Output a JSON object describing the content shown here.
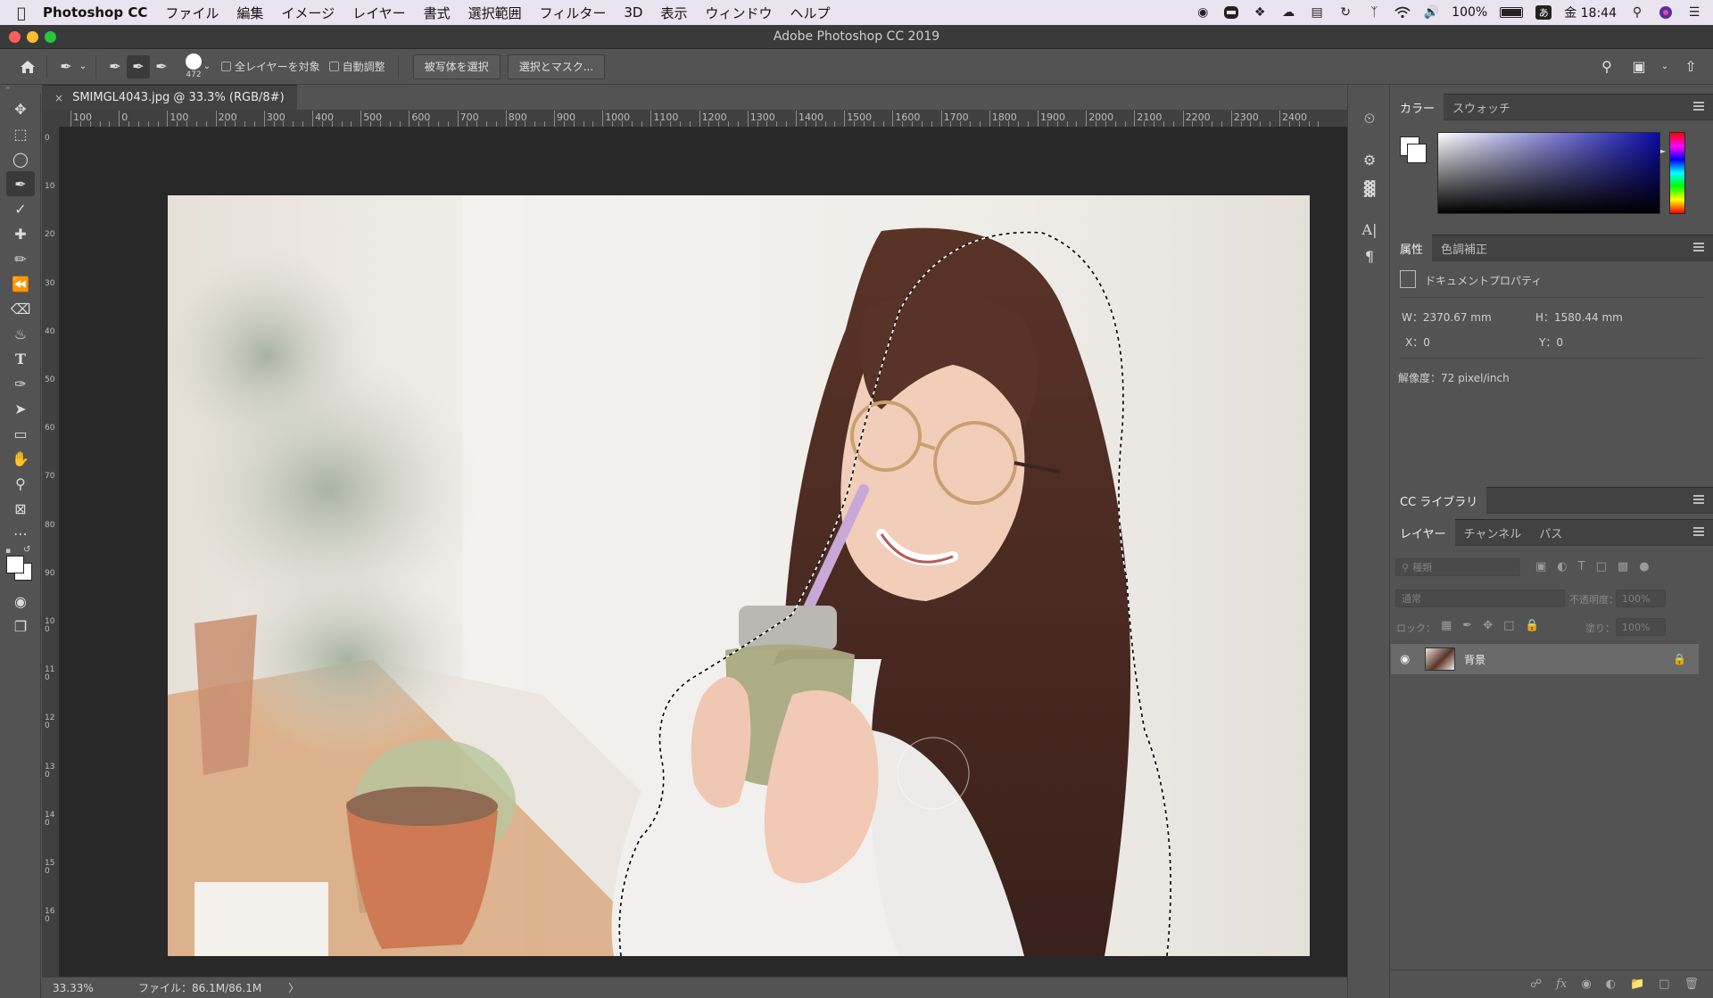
{
  "menubar": {
    "app_name": "Photoshop CC",
    "items": [
      "ファイル",
      "編集",
      "イメージ",
      "レイヤー",
      "書式",
      "選択範囲",
      "フィルター",
      "3D",
      "表示",
      "ウィンドウ",
      "ヘルプ"
    ],
    "battery": "100%",
    "ime": "あ",
    "clock": "金 18:44"
  },
  "window": {
    "title": "Adobe Photoshop CC 2019"
  },
  "options": {
    "brush_size": "472",
    "sample_all_layers": "全レイヤーを対象",
    "auto_enhance": "自動調整",
    "select_subject": "被写体を選択",
    "select_and_mask": "選択とマスク..."
  },
  "document": {
    "tab_title": "SMIMGL4043.jpg @ 33.3% (RGB/8#)",
    "close_glyph": "×",
    "ruler_top": [
      "100",
      "0",
      "100",
      "200",
      "300",
      "400",
      "500",
      "600",
      "700",
      "800",
      "900",
      "1000",
      "1100",
      "1200",
      "1300",
      "1400",
      "1500",
      "1600",
      "1700",
      "1800",
      "1900",
      "2000",
      "2100",
      "2200",
      "2300",
      "2400"
    ],
    "ruler_left": [
      "0",
      "1 0",
      "2 0",
      "3 0",
      "4 0",
      "5 0",
      "6 0",
      "7 0",
      "8 0",
      "9 0",
      "1 0 0",
      "1 1 0",
      "1 2 0",
      "1 3 0",
      "1 4 0",
      "1 5 0",
      "1 6 0"
    ]
  },
  "status": {
    "zoom": "33.33%",
    "file_info": "ファイル：86.1M/86.1M",
    "arrow": "〉"
  },
  "color_panel": {
    "tabs": [
      "カラー",
      "スウォッチ"
    ],
    "active_tab": "カラー",
    "hue_color": "#0a0aa8"
  },
  "properties_panel": {
    "tabs": [
      "属性",
      "色調補正"
    ],
    "header": "ドキュメントプロパティ",
    "width": "W：2370.67 mm",
    "height": "H：1580.44 mm",
    "x": "X：0",
    "y": "Y：0",
    "resolution": "解像度：72 pixel/inch"
  },
  "libraries_panel": {
    "title": "CC ライブラリ"
  },
  "layers_panel": {
    "tabs": [
      "レイヤー",
      "チャンネル",
      "パス"
    ],
    "search_placeholder": "種類",
    "blend_mode": "通常",
    "opacity_label": "不透明度：",
    "opacity_value": "100%",
    "lock_label": "ロック：",
    "fill_label": "塗り：",
    "fill_value": "100%",
    "layers": [
      {
        "name": "背景"
      }
    ]
  }
}
